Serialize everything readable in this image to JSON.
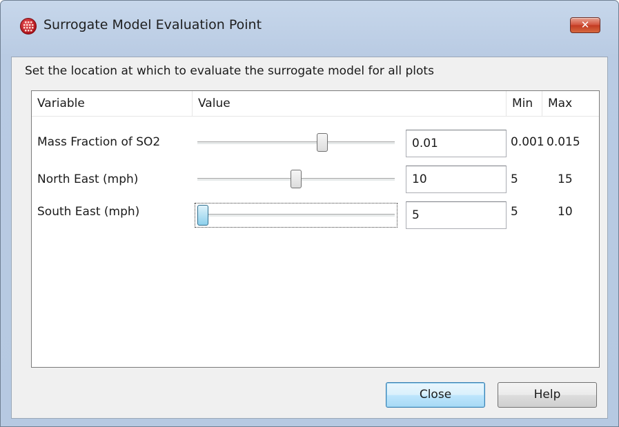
{
  "window": {
    "title": "Surrogate Model Evaluation Point",
    "close_glyph": "✕",
    "icon": "grid-globe-icon"
  },
  "instruction": "Set the location at which to evaluate the surrogate model for all plots",
  "table": {
    "columns": [
      "Variable",
      "Value",
      "Min",
      "Max"
    ],
    "rows": [
      {
        "label": "Mass Fraction of SO2",
        "value": "0.01",
        "min": "0.001",
        "max": "0.015",
        "slider_fraction": 0.64
      },
      {
        "label": "North East (mph)",
        "value": "10",
        "min": "5",
        "max": "15",
        "slider_fraction": 0.5
      },
      {
        "label": "South East (mph)",
        "value": "5",
        "min": "5",
        "max": "10",
        "slider_fraction": 0.0
      }
    ]
  },
  "buttons": {
    "close": "Close",
    "help": "Help"
  },
  "colors": {
    "frame": "#b9cbe3",
    "close_button": "#c23a22",
    "focus_thumb": "#8dd0ec"
  }
}
